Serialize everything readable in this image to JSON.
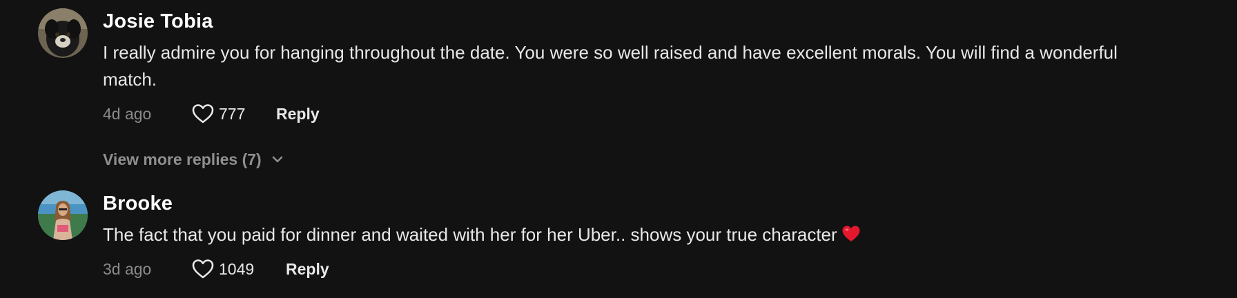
{
  "comments": [
    {
      "username": "Josie Tobia",
      "text": "I really admire you for hanging throughout the date. You were so well raised and have excellent morals. You will find a wonderful match.",
      "timestamp": "4d ago",
      "likes": "777",
      "reply_label": "Reply",
      "view_more_label": "View more replies (7)"
    },
    {
      "username": "Brooke",
      "text": "The fact that you paid for dinner and waited with her for her Uber.. shows your true character",
      "emoji": "red-heart-emoji",
      "timestamp": "3d ago",
      "likes": "1049",
      "reply_label": "Reply"
    }
  ],
  "colors": {
    "background": "#121212",
    "username": "#ffffff",
    "body_text": "#e8e8e8",
    "muted": "#8a8a8a",
    "heart_emoji": "#e3182d"
  }
}
